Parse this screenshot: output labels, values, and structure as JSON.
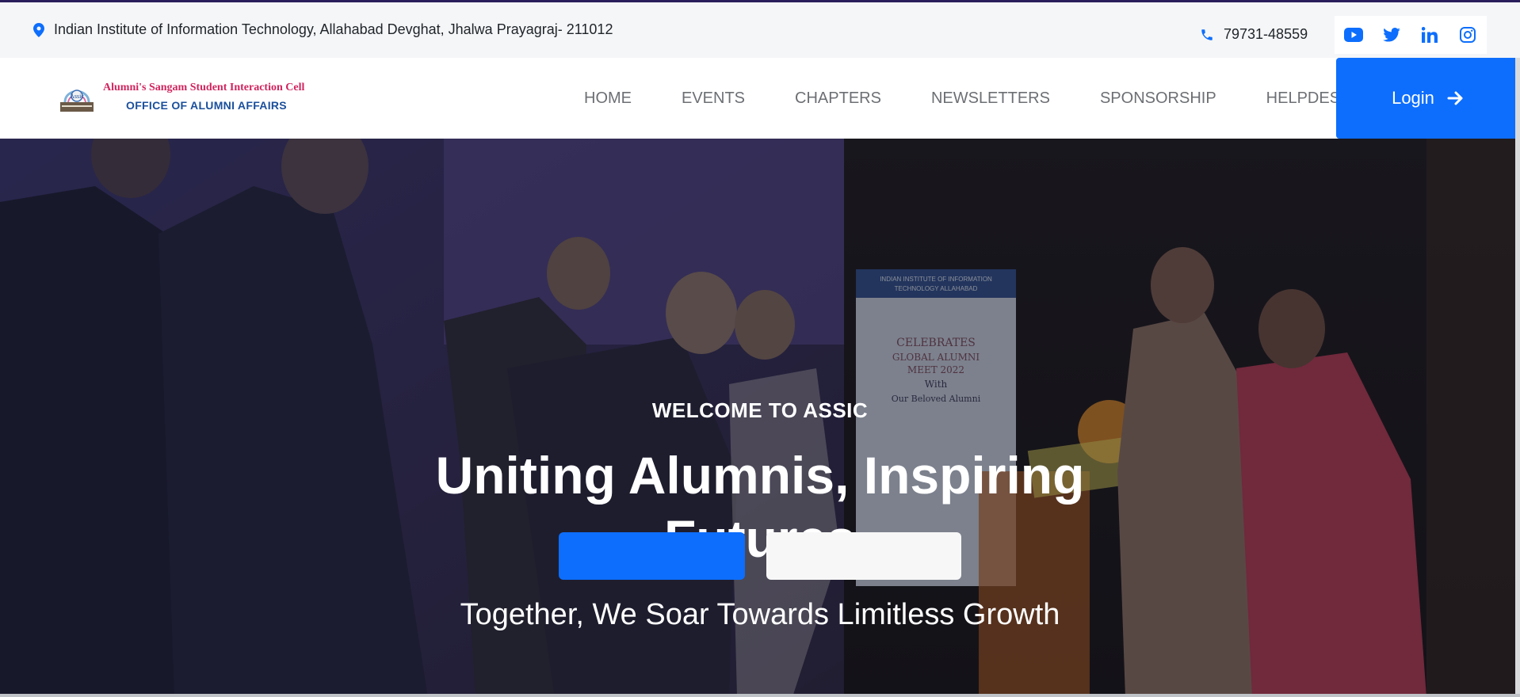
{
  "topbar": {
    "address": "Indian Institute of Information Technology, Allahabad Devghat, Jhalwa Prayagraj- 211012",
    "phone": "79731-48559",
    "socials": [
      {
        "name": "youtube-icon",
        "color": "#0d6efd"
      },
      {
        "name": "twitter-icon",
        "color": "#0d6efd"
      },
      {
        "name": "linkedin-icon",
        "color": "#0d6efd"
      },
      {
        "name": "instagram-icon",
        "color": "#0d6efd"
      }
    ]
  },
  "logo": {
    "line1": "Alumni's Sangam Student Interaction Cell",
    "line2": "OFFICE OF ALUMNI AFFAIRS",
    "emblem_text": "Assic"
  },
  "nav": {
    "items": [
      "HOME",
      "EVENTS",
      "CHAPTERS",
      "NEWSLETTERS",
      "SPONSORSHIP",
      "HELPDESK"
    ],
    "login_label": "Login"
  },
  "hero": {
    "eyebrow": "WELCOME TO ASSIC",
    "title": "Uniting Alumnis, Inspiring Futures",
    "subtitle": "Together, We Soar Towards Limitless Growth",
    "banner_lines": [
      "INDIAN INSTITUTE OF INFORMATION",
      "TECHNOLOGY ALLAHABAD",
      "CELEBRATES",
      "GLOBAL ALUMNI",
      "MEET 2022",
      "With",
      "Our Beloved Alumni"
    ]
  },
  "colors": {
    "accent": "#0d6efd",
    "top_accent": "#2a1f5c",
    "logo_pink": "#d0245e",
    "logo_blue": "#1b4f9c"
  }
}
